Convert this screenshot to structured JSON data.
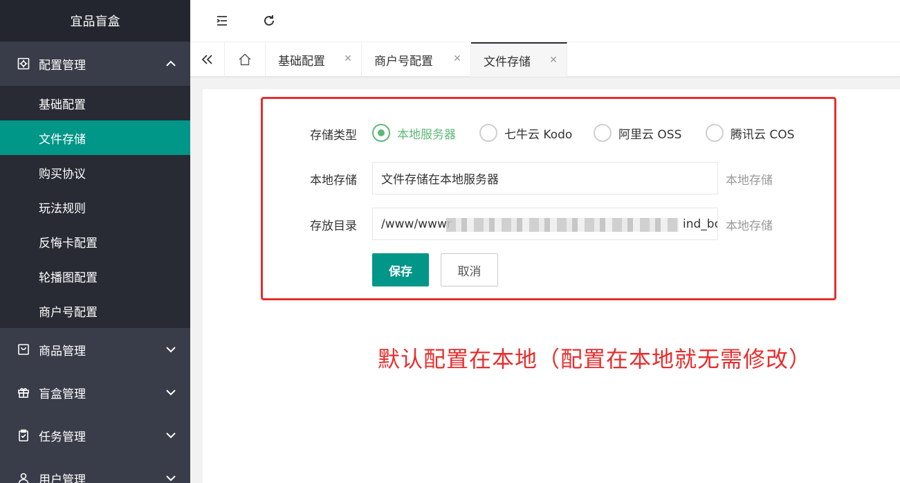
{
  "app": {
    "title": "宜品盲盒"
  },
  "sidebar": {
    "groups": [
      {
        "label": "配置管理",
        "icon": "settings-gear-icon",
        "expanded": true
      },
      {
        "label": "商品管理",
        "icon": "shopping-bag-icon",
        "expanded": false
      },
      {
        "label": "盲盒管理",
        "icon": "gift-icon",
        "expanded": false
      },
      {
        "label": "任务管理",
        "icon": "clipboard-check-icon",
        "expanded": false
      },
      {
        "label": "用户管理",
        "icon": "user-icon",
        "expanded": false
      }
    ],
    "config_items": [
      "基础配置",
      "文件存储",
      "购买协议",
      "玩法规则",
      "反悔卡配置",
      "轮播图配置",
      "商户号配置"
    ],
    "active_item": "文件存储"
  },
  "tabs": [
    {
      "label": "基础配置",
      "active": false
    },
    {
      "label": "商户号配置",
      "active": false
    },
    {
      "label": "文件存储",
      "active": true
    }
  ],
  "form": {
    "storage_type_label": "存储类型",
    "storage_options": [
      "本地服务器",
      "七牛云 Kodo",
      "阿里云 OSS",
      "腾讯云 COS"
    ],
    "selected_option": "本地服务器",
    "local_storage_label": "本地存储",
    "local_storage_value": "文件存储在本地服务器",
    "local_storage_aux": "本地存储",
    "directory_label": "存放目录",
    "directory_value_start": "/www/wwwr",
    "directory_value_end": "ind_bo",
    "directory_aux": "本地存储",
    "save_label": "保存",
    "cancel_label": "取消"
  },
  "annotation": {
    "text": "默认配置在本地（配置在本地就无需修改）",
    "color": "#e82d2d"
  },
  "colors": {
    "accent": "#009688",
    "radio_checked": "#5fb878",
    "sidebar_bg": "#393d49"
  }
}
